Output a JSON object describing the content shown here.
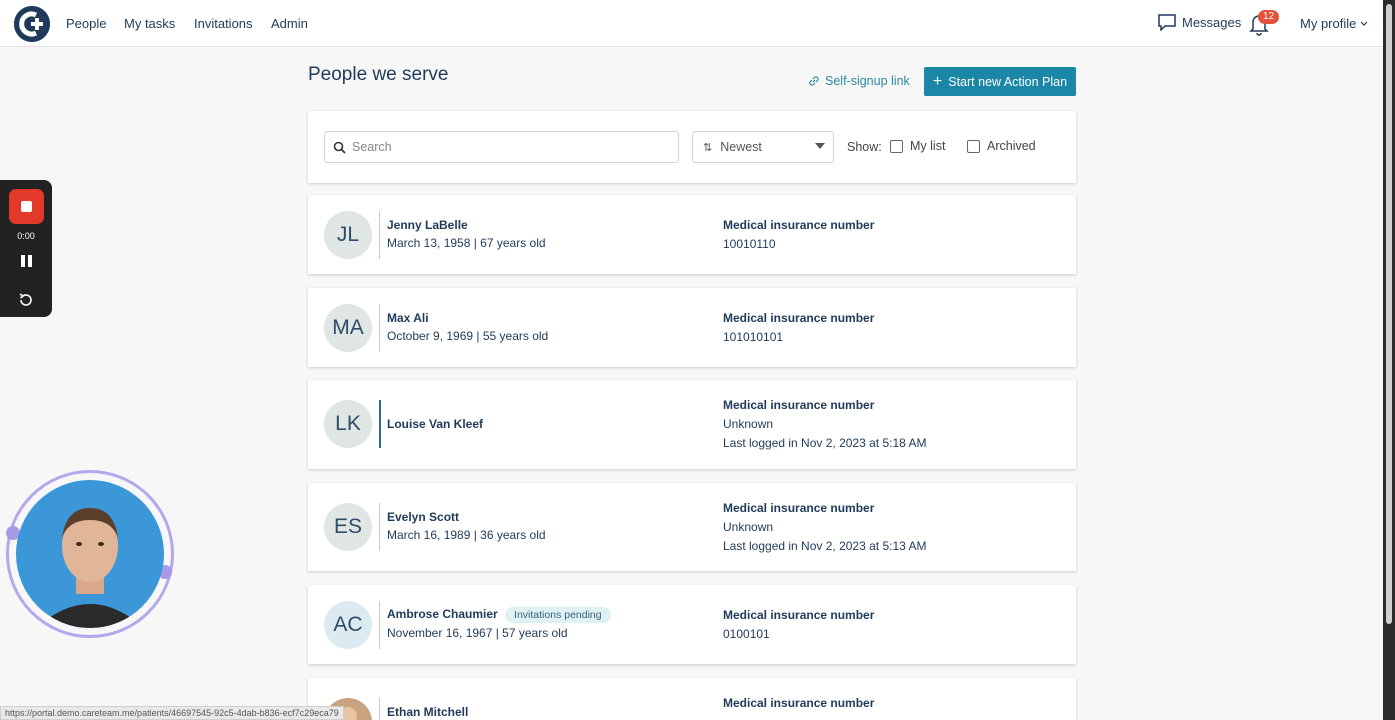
{
  "nav": {
    "links": [
      "People",
      "My tasks",
      "Invitations",
      "Admin"
    ],
    "messages": "Messages",
    "notification_count": "12",
    "profile": "My profile"
  },
  "header": {
    "title": "People we serve",
    "self_signup": "Self-signup link",
    "start_plan": "Start new Action Plan"
  },
  "filters": {
    "search_placeholder": "Search",
    "sort_value": "Newest",
    "show_label": "Show:",
    "my_list": "My list",
    "archived": "Archived"
  },
  "patients": [
    {
      "initials": "JL",
      "name": "Jenny LaBelle",
      "dob": "March 13, 1958 | 67 years old",
      "mlabel": "Medical insurance number",
      "mval": "10010110"
    },
    {
      "initials": "MA",
      "name": "Max Ali",
      "dob": "October 9, 1969 | 55 years old",
      "mlabel": "Medical insurance number",
      "mval": "101010101"
    },
    {
      "initials": "LK",
      "name": "Louise Van Kleef",
      "dob": "",
      "mlabel": "Medical insurance number",
      "mval": "Unknown",
      "last": "Last logged in Nov 2, 2023 at 5:18 AM"
    },
    {
      "initials": "ES",
      "name": "Evelyn Scott",
      "dob": "March 16, 1989 | 36 years old",
      "mlabel": "Medical insurance number",
      "mval": "Unknown",
      "last": "Last logged in Nov 2, 2023 at 5:13 AM"
    },
    {
      "initials": "AC",
      "name": "Ambrose Chaumier",
      "badge": "Invitations pending",
      "dob": "November 16, 1967 | 57 years old",
      "mlabel": "Medical insurance number",
      "mval": "0100101"
    },
    {
      "name": "Ethan Mitchell",
      "mlabel": "Medical insurance number"
    }
  ],
  "recorder": {
    "time": "0:00"
  },
  "status_url": "https://portal.demo.careteam.me/patients/46697545-92c5-4dab-b836-ecf7c29eca79",
  "colors": {
    "navy": "#1f3a5a",
    "accent": "#1b87a6",
    "badge": "#e4513a"
  }
}
